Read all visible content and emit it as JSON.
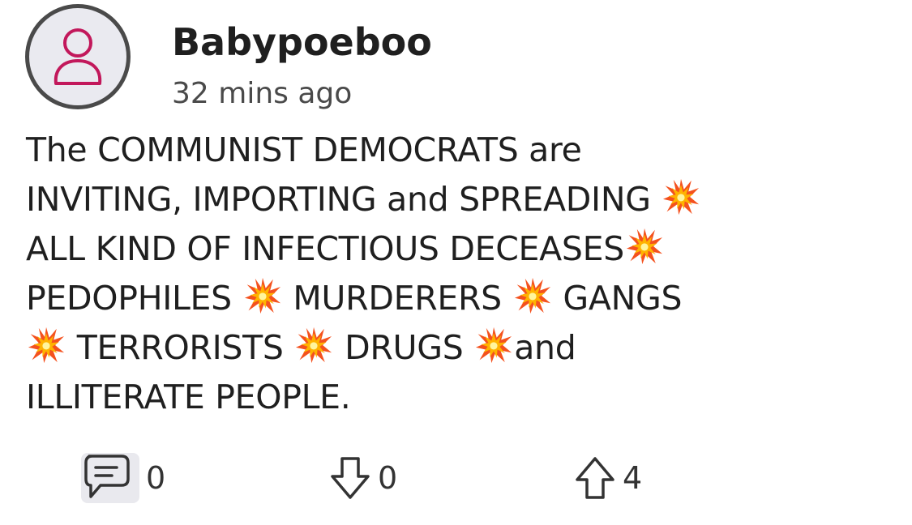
{
  "post": {
    "author": {
      "username": "Babypoeboo",
      "avatar_icon": "user-outline-icon",
      "avatar_color": "#c2185b"
    },
    "timestamp": "32 mins ago",
    "body_lines": [
      [
        "The COMMUNIST DEMOCRATS are"
      ],
      [
        "INVITING, IMPORTING and SPREADING",
        "burst"
      ],
      [
        "ALL KIND OF INFECTIOUS DECEASES",
        "burst"
      ],
      [
        "PEDOPHILES",
        "burst",
        "MURDERERS",
        "burst",
        "GANGS"
      ],
      [
        "burst",
        "TERRORISTS",
        "burst",
        "DRUGS",
        "burst",
        "and"
      ],
      [
        "ILLITERATE PEOPLE."
      ]
    ],
    "emoji_icon": "collision-emoji-icon",
    "actions": {
      "comment": {
        "icon": "comment-icon",
        "count": "0"
      },
      "downvote": {
        "icon": "arrow-down-icon",
        "count": "0"
      },
      "upvote": {
        "icon": "arrow-up-icon",
        "count": "4"
      }
    }
  }
}
